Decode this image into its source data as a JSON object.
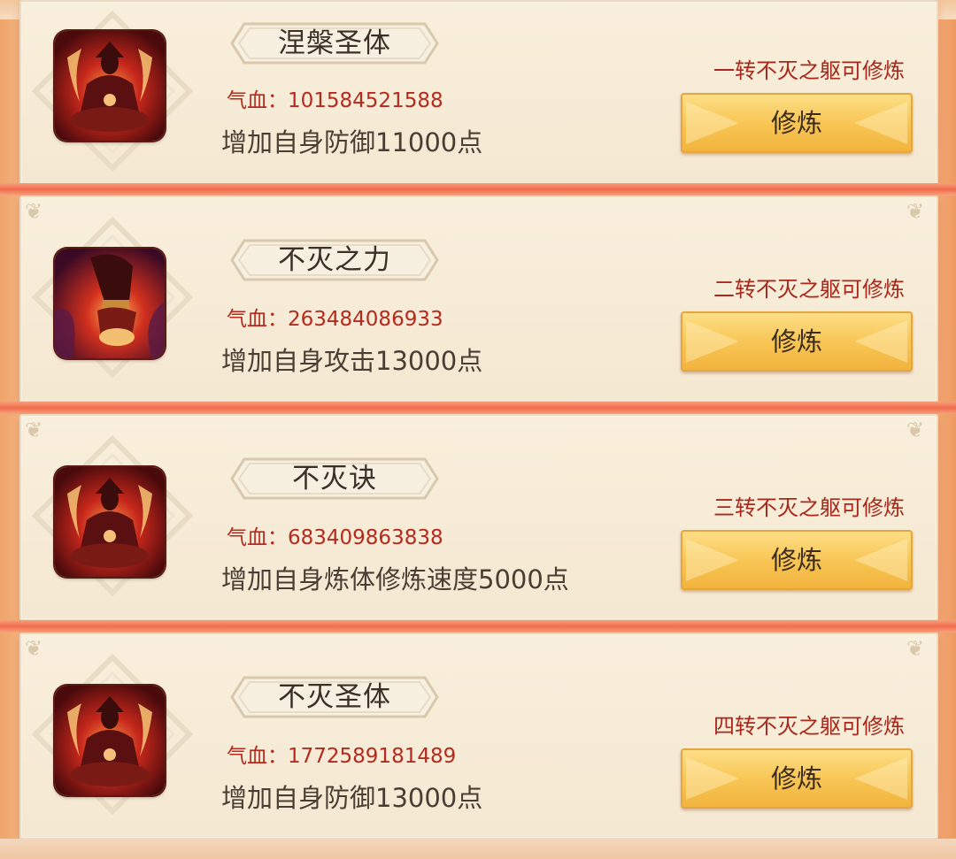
{
  "entries": [
    {
      "title": "涅槃圣体",
      "hp": "气血：101584521588",
      "desc": "增加自身防御11000点",
      "requirement": "一转不灭之躯可修炼",
      "button": "修炼",
      "icon": "meditating-figure-icon"
    },
    {
      "title": "不灭之力",
      "hp": "气血：263484086933",
      "desc": "增加自身攻击13000点",
      "requirement": "二转不灭之躯可修炼",
      "button": "修炼",
      "icon": "flaming-fist-icon"
    },
    {
      "title": "不灭诀",
      "hp": "气血：683409863838",
      "desc": "增加自身炼体修炼速度5000点",
      "requirement": "三转不灭之躯可修炼",
      "button": "修炼",
      "icon": "meditating-figure-icon"
    },
    {
      "title": "不灭圣体",
      "hp": "气血：1772589181489",
      "desc": "增加自身防御13000点",
      "requirement": "四转不灭之躯可修炼",
      "button": "修炼",
      "icon": "meditating-figure-icon"
    }
  ],
  "colors": {
    "requirement_red": "#a8281b",
    "hp_red": "#b52a1d",
    "button_gold": "#f8c655"
  }
}
